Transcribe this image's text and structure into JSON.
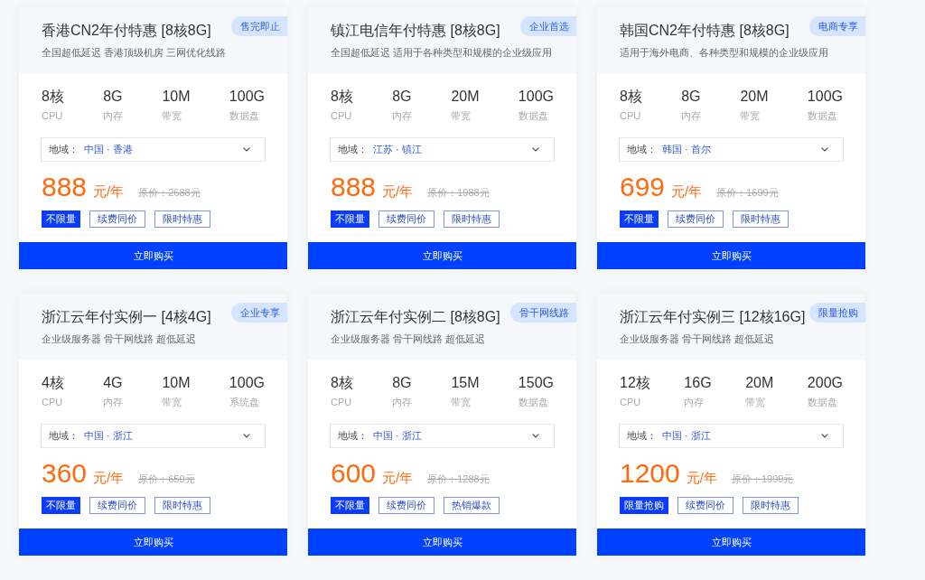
{
  "plans": [
    {
      "title": "香港CN2年付特惠 [8核8G]",
      "badge": "售完即止",
      "subtitle": "全国超低延迟 香港顶级机房 三网优化线路",
      "specs": [
        {
          "value": "8核",
          "label": "CPU"
        },
        {
          "value": "8G",
          "label": "内存"
        },
        {
          "value": "10M",
          "label": "带宽"
        },
        {
          "value": "100G",
          "label": "数据盘"
        }
      ],
      "region": {
        "label": "地域：",
        "value": "中国 · 香港"
      },
      "price": "888",
      "unit": "元/年",
      "original_price": "原价：2688元",
      "tags": [
        {
          "text": "不限量",
          "kind": "filled"
        },
        {
          "text": "续费同价",
          "kind": "outline"
        },
        {
          "text": "限时特惠",
          "kind": "outline"
        }
      ],
      "button": "立即购买"
    },
    {
      "title": "镇江电信年付特惠 [8核8G]",
      "badge": "企业首选",
      "subtitle": "全国超低延迟 适用于各种类型和规模的企业级应用",
      "specs": [
        {
          "value": "8核",
          "label": "CPU"
        },
        {
          "value": "8G",
          "label": "内存"
        },
        {
          "value": "20M",
          "label": "带宽"
        },
        {
          "value": "100G",
          "label": "数据盘"
        }
      ],
      "region": {
        "label": "地域：",
        "value": "江苏 · 镇江"
      },
      "price": "888",
      "unit": "元/年",
      "original_price": "原价：1988元",
      "tags": [
        {
          "text": "不限量",
          "kind": "filled"
        },
        {
          "text": "续费同价",
          "kind": "outline"
        },
        {
          "text": "限时特惠",
          "kind": "outline"
        }
      ],
      "button": "立即购买"
    },
    {
      "title": "韩国CN2年付特惠 [8核8G]",
      "badge": "电商专享",
      "subtitle": "适用于海外电商、各种类型和规模的企业级应用",
      "specs": [
        {
          "value": "8核",
          "label": "CPU"
        },
        {
          "value": "8G",
          "label": "内存"
        },
        {
          "value": "20M",
          "label": "带宽"
        },
        {
          "value": "100G",
          "label": "数据盘"
        }
      ],
      "region": {
        "label": "地域：",
        "value": "韩国 · 首尔"
      },
      "price": "699",
      "unit": "元/年",
      "original_price": "原价：1699元",
      "tags": [
        {
          "text": "不限量",
          "kind": "filled"
        },
        {
          "text": "续费同价",
          "kind": "outline"
        },
        {
          "text": "限时特惠",
          "kind": "outline"
        }
      ],
      "button": "立即购买"
    },
    {
      "title": "浙江云年付实例一 [4核4G]",
      "badge": "企业专享",
      "subtitle": "企业级服务器 骨干网线路 超低延迟",
      "specs": [
        {
          "value": "4核",
          "label": "CPU"
        },
        {
          "value": "4G",
          "label": "内存"
        },
        {
          "value": "10M",
          "label": "带宽"
        },
        {
          "value": "100G",
          "label": "系统盘"
        }
      ],
      "region": {
        "label": "地域：",
        "value": "中国 · 浙江"
      },
      "price": "360",
      "unit": "元/年",
      "original_price": "原价：650元",
      "tags": [
        {
          "text": "不限量",
          "kind": "filled"
        },
        {
          "text": "续费同价",
          "kind": "outline"
        },
        {
          "text": "限时特惠",
          "kind": "outline"
        }
      ],
      "button": "立即购买"
    },
    {
      "title": "浙江云年付实例二 [8核8G]",
      "badge": "骨干网线路",
      "subtitle": "企业级服务器 骨干网线路 超低延迟",
      "specs": [
        {
          "value": "8核",
          "label": "CPU"
        },
        {
          "value": "8G",
          "label": "内存"
        },
        {
          "value": "15M",
          "label": "带宽"
        },
        {
          "value": "150G",
          "label": "数据盘"
        }
      ],
      "region": {
        "label": "地域：",
        "value": "中国 · 浙江"
      },
      "price": "600",
      "unit": "元/年",
      "original_price": "原价：1288元",
      "tags": [
        {
          "text": "不限量",
          "kind": "filled"
        },
        {
          "text": "续费同价",
          "kind": "outline"
        },
        {
          "text": "热销爆款",
          "kind": "outline"
        }
      ],
      "button": "立即购买"
    },
    {
      "title": "浙江云年付实例三 [12核16G]",
      "badge": "限量抢购",
      "subtitle": "企业级服务器 骨干网线路 超低延迟",
      "specs": [
        {
          "value": "12核",
          "label": "CPU"
        },
        {
          "value": "16G",
          "label": "内存"
        },
        {
          "value": "20M",
          "label": "带宽"
        },
        {
          "value": "200G",
          "label": "数据盘"
        }
      ],
      "region": {
        "label": "地域：",
        "value": "中国 · 浙江"
      },
      "price": "1200",
      "unit": "元/年",
      "original_price": "原价：1999元",
      "tags": [
        {
          "text": "限量抢购",
          "kind": "filled"
        },
        {
          "text": "续费同价",
          "kind": "outline"
        },
        {
          "text": "限时特惠",
          "kind": "outline"
        }
      ],
      "button": "立即购买"
    }
  ]
}
